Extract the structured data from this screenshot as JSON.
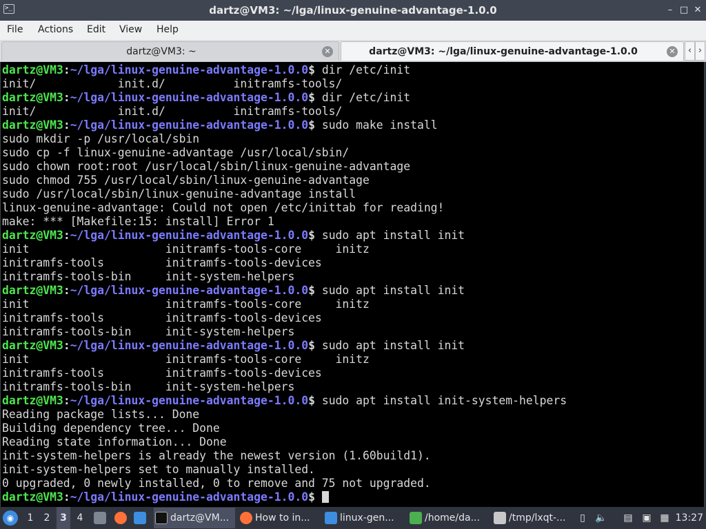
{
  "window": {
    "title": "dartz@VM3: ~/lga/linux-genuine-advantage-1.0.0",
    "buttons": {
      "minimize": "–",
      "maximize": "□",
      "close": "✕"
    }
  },
  "menu": [
    "File",
    "Actions",
    "Edit",
    "View",
    "Help"
  ],
  "tabs": [
    {
      "label": "dartz@VM3: ~",
      "active": false
    },
    {
      "label": "dartz@VM3: ~/lga/linux-genuine-advantage-1.0.0",
      "active": true
    }
  ],
  "terminal": {
    "prompt": {
      "user_host": "dartz@VM3",
      "colon": ":",
      "path": "~/lga/linux-genuine-advantage-1.0.0",
      "dollar": "$"
    },
    "lines": [
      {
        "p": true,
        "cmd": " dir /etc/init"
      },
      {
        "t": "init/            init.d/          initramfs-tools/"
      },
      {
        "p": true,
        "cmd": " dir /etc/init"
      },
      {
        "t": "init/            init.d/          initramfs-tools/"
      },
      {
        "p": true,
        "cmd": " sudo make install"
      },
      {
        "t": "sudo mkdir -p /usr/local/sbin"
      },
      {
        "t": "sudo cp -f linux-genuine-advantage /usr/local/sbin/"
      },
      {
        "t": "sudo chown root:root /usr/local/sbin/linux-genuine-advantage"
      },
      {
        "t": "sudo chmod 755 /usr/local/sbin/linux-genuine-advantage"
      },
      {
        "t": "sudo /usr/local/sbin/linux-genuine-advantage install"
      },
      {
        "t": "linux-genuine-advantage: Could not open /etc/inittab for reading!"
      },
      {
        "t": "make: *** [Makefile:15: install] Error 1"
      },
      {
        "p": true,
        "cmd": " sudo apt install init"
      },
      {
        "t": "init                    initramfs-tools-core     initz"
      },
      {
        "t": "initramfs-tools         initramfs-tools-devices"
      },
      {
        "t": "initramfs-tools-bin     init-system-helpers"
      },
      {
        "p": true,
        "cmd": " sudo apt install init"
      },
      {
        "t": "init                    initramfs-tools-core     initz"
      },
      {
        "t": "initramfs-tools         initramfs-tools-devices"
      },
      {
        "t": "initramfs-tools-bin     init-system-helpers"
      },
      {
        "p": true,
        "cmd": " sudo apt install init"
      },
      {
        "t": "init                    initramfs-tools-core     initz"
      },
      {
        "t": "initramfs-tools         initramfs-tools-devices"
      },
      {
        "t": "initramfs-tools-bin     init-system-helpers"
      },
      {
        "p": true,
        "cmd": " sudo apt install init-system-helpers"
      },
      {
        "t": "Reading package lists... Done"
      },
      {
        "t": "Building dependency tree... Done"
      },
      {
        "t": "Reading state information... Done"
      },
      {
        "t": "init-system-helpers is already the newest version (1.60build1)."
      },
      {
        "t": "init-system-helpers set to manually installed."
      },
      {
        "t": "0 upgraded, 0 newly installed, 0 to remove and 75 not upgraded."
      },
      {
        "p": true,
        "cmd": " ",
        "cursor": true
      }
    ]
  },
  "taskbar": {
    "workspaces": [
      "1",
      "2",
      "3",
      "4"
    ],
    "active_workspace": "3",
    "tasks": [
      {
        "label": "dartz@VM...",
        "icon": "terminal-icon",
        "active": true
      },
      {
        "label": "How to in...",
        "icon": "firefox-icon",
        "active": false
      },
      {
        "label": "linux-gen...",
        "icon": "folder-icon",
        "active": false
      },
      {
        "label": "/home/da...",
        "icon": "text-editor-icon",
        "active": false
      },
      {
        "label": "/tmp/lxqt-...",
        "icon": "document-edit-icon",
        "active": false
      }
    ],
    "clock": "13:27"
  },
  "colors": {
    "prompt_user": "#4ee54e",
    "prompt_path": "#7b7bff",
    "terminal_bg": "#000000",
    "terminal_fg": "#d8d8d8",
    "titlebar_bg": "#3f4551",
    "taskbar_bg": "#2f343f"
  }
}
